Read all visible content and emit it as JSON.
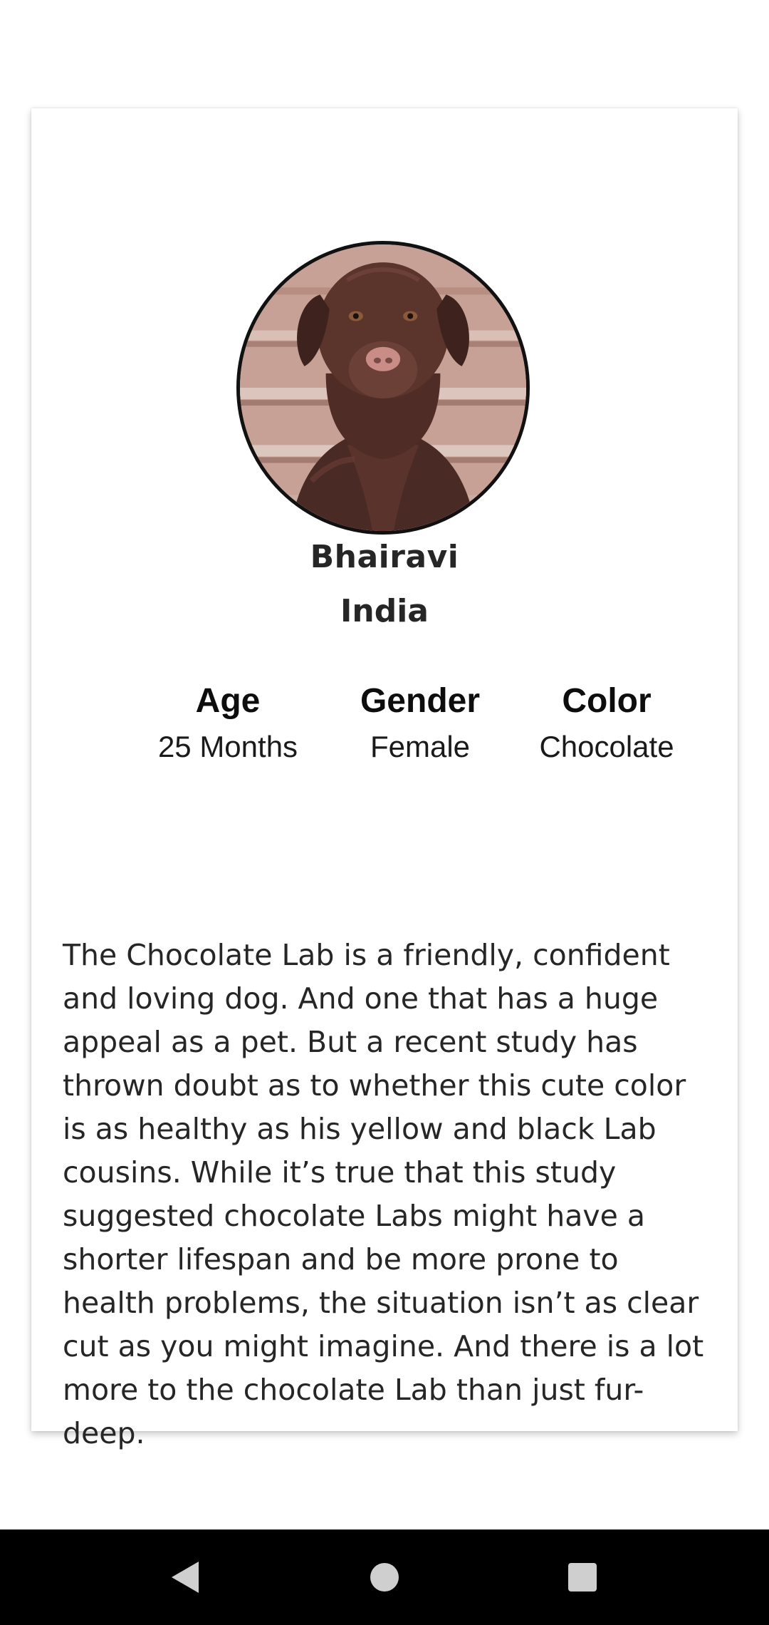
{
  "profile": {
    "photo_alt": "chocolate-labrador-photo",
    "name": "Bhairavi",
    "country": "India"
  },
  "stats": [
    {
      "label": "Age",
      "value": "25 Months"
    },
    {
      "label": "Gender",
      "value": "Female"
    },
    {
      "label": "Color",
      "value": "Chocolate"
    }
  ],
  "description": "The Chocolate Lab is a friendly, confident and loving dog. And one that has a huge appeal as a pet. But a recent study has thrown doubt as to whether this cute color is as healthy as his yellow and black Lab cousins. While it’s true that this study suggested chocolate Labs might have a shorter lifespan and be more prone to health problems, the situation isn’t as clear cut as you might imagine. And there is a lot more to the chocolate Lab than just fur-deep.",
  "nav": {
    "back_icon": "back-triangle-icon",
    "home_icon": "home-circle-icon",
    "recents_icon": "recents-square-icon"
  },
  "colors": {
    "background": "#ffffff",
    "text": "#262626",
    "navbar": "#000000",
    "nav_icons": "#cfcfcf"
  }
}
